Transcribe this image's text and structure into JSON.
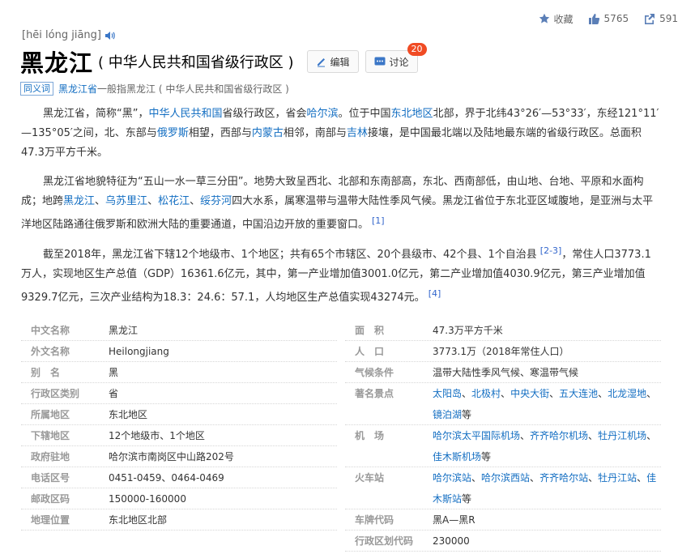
{
  "topbar": {
    "favorite_label": "收藏",
    "like_count": "5765",
    "share_count": "591"
  },
  "pinyin": "[hēi lóng jiāng]",
  "title": {
    "main": "黑龙江",
    "sub": "( 中华人民共和国省级行政区 )",
    "edit_label": "编辑",
    "discuss_label": "讨论",
    "discuss_badge": "20"
  },
  "synonym": {
    "tag": "同义词",
    "link": "黑龙江省",
    "text": "一般指黑龙江 ( 中华人民共和国省级行政区 )"
  },
  "para1": {
    "t1": "黑龙江省，简称“黑”，",
    "l1": "中华人民共和国",
    "t2": "省级行政区，省会",
    "l2": "哈尔滨",
    "t3": "。位于中国",
    "l3": "东北地区",
    "t4": "北部，界于北纬43°26′—53°33′，东经121°11′—135°05′之间，北、东部与",
    "l4": "俄罗斯",
    "t5": "相望，西部与",
    "l5": "内蒙古",
    "t6": "相邻，南部与",
    "l6": "吉林",
    "t7": "接壤，是中国最北端以及陆地最东端的省级行政区。总面积47.3万平方千米。"
  },
  "para2": {
    "t1": "黑龙江省地貌特征为“五山一水一草三分田”。地势大致呈西北、北部和东南部高，东北、西南部低，由山地、台地、平原和水面构成；地跨",
    "l1": "黑龙江",
    "s1": "、",
    "l2": "乌苏里江",
    "s2": "、",
    "l3": "松花江",
    "s3": "、",
    "l4": "绥芬河",
    "t2": "四大水系，属寒温带与温带大陆性季风气候。黑龙江省位于东北亚区域腹地，是亚洲与太平洋地区陆路通往俄罗斯和欧洲大陆的重要通道，中国沿边开放的重要窗口。",
    "ref": "[1]"
  },
  "para3": {
    "t1": "截至2018年，黑龙江省下辖12个地级市、1个地区；共有65个市辖区、20个县级市、42个县、1个自治县",
    "ref1": "[2-3]",
    "t2": "，常住人口3773.1万人，实现地区生产总值（GDP）16361.6亿元，其中，第一产业增加值3001.0亿元，第二产业增加值4030.9亿元，第三产业增加值9329.7亿元，三次产业结构为18.3：24.6：57.1，人均地区生产总值实现43274元。",
    "ref2": "[4]"
  },
  "info": {
    "left": [
      {
        "k": "中文名称",
        "v": "黑龙江"
      },
      {
        "k": "外文名称",
        "v": "Heilongjiang"
      },
      {
        "k": "别　名",
        "v": "黑"
      },
      {
        "k": "行政区类别",
        "v": "省"
      },
      {
        "k": "所属地区",
        "v": "东北地区"
      },
      {
        "k": "下辖地区",
        "v": "12个地级市、1个地区"
      },
      {
        "k": "政府驻地",
        "v": "哈尔滨市南岗区中山路202号"
      },
      {
        "k": "电话区号",
        "v": "0451-0459、0464-0469"
      },
      {
        "k": "邮政区码",
        "v": "150000-160000"
      },
      {
        "k": "地理位置",
        "v": "东北地区北部"
      }
    ],
    "right": {
      "area": {
        "k": "面　积",
        "v": "47.3万平方千米"
      },
      "population": {
        "k": "人　口",
        "v": "3773.1万（2018年常住人口）"
      },
      "climate": {
        "k": "气候条件",
        "v": "温带大陆性季风气候、寒温带气候"
      },
      "scenic": {
        "k": "著名景点",
        "l1": "太阳岛",
        "s1": "、",
        "l2": "北极村",
        "s2": "、",
        "l3": "中央大街",
        "s3": "、",
        "l4": "五大连池",
        "s4": "、",
        "l5": "北龙湿地",
        "s5": "、",
        "l6": "镜泊湖",
        "tail": "等"
      },
      "airport": {
        "k": "机　场",
        "l1": "哈尔滨太平国际机场",
        "s1": "、",
        "l2": "齐齐哈尔机场",
        "s2": "、",
        "l3": "牡丹江机场",
        "s3": "、",
        "l4": "佳木斯机场",
        "tail": "等"
      },
      "station": {
        "k": "火车站",
        "l1": "哈尔滨站",
        "s1": "、",
        "l2": "哈尔滨西站",
        "s2": "、",
        "l3": "齐齐哈尔站",
        "s3": "、",
        "l4": "牡丹江站",
        "s4": "、",
        "l5": "佳木斯站",
        "tail": "等"
      },
      "plate": {
        "k": "车牌代码",
        "v": "黑A—黑R"
      },
      "code": {
        "k": "行政区划代码",
        "v": "230000"
      }
    }
  }
}
